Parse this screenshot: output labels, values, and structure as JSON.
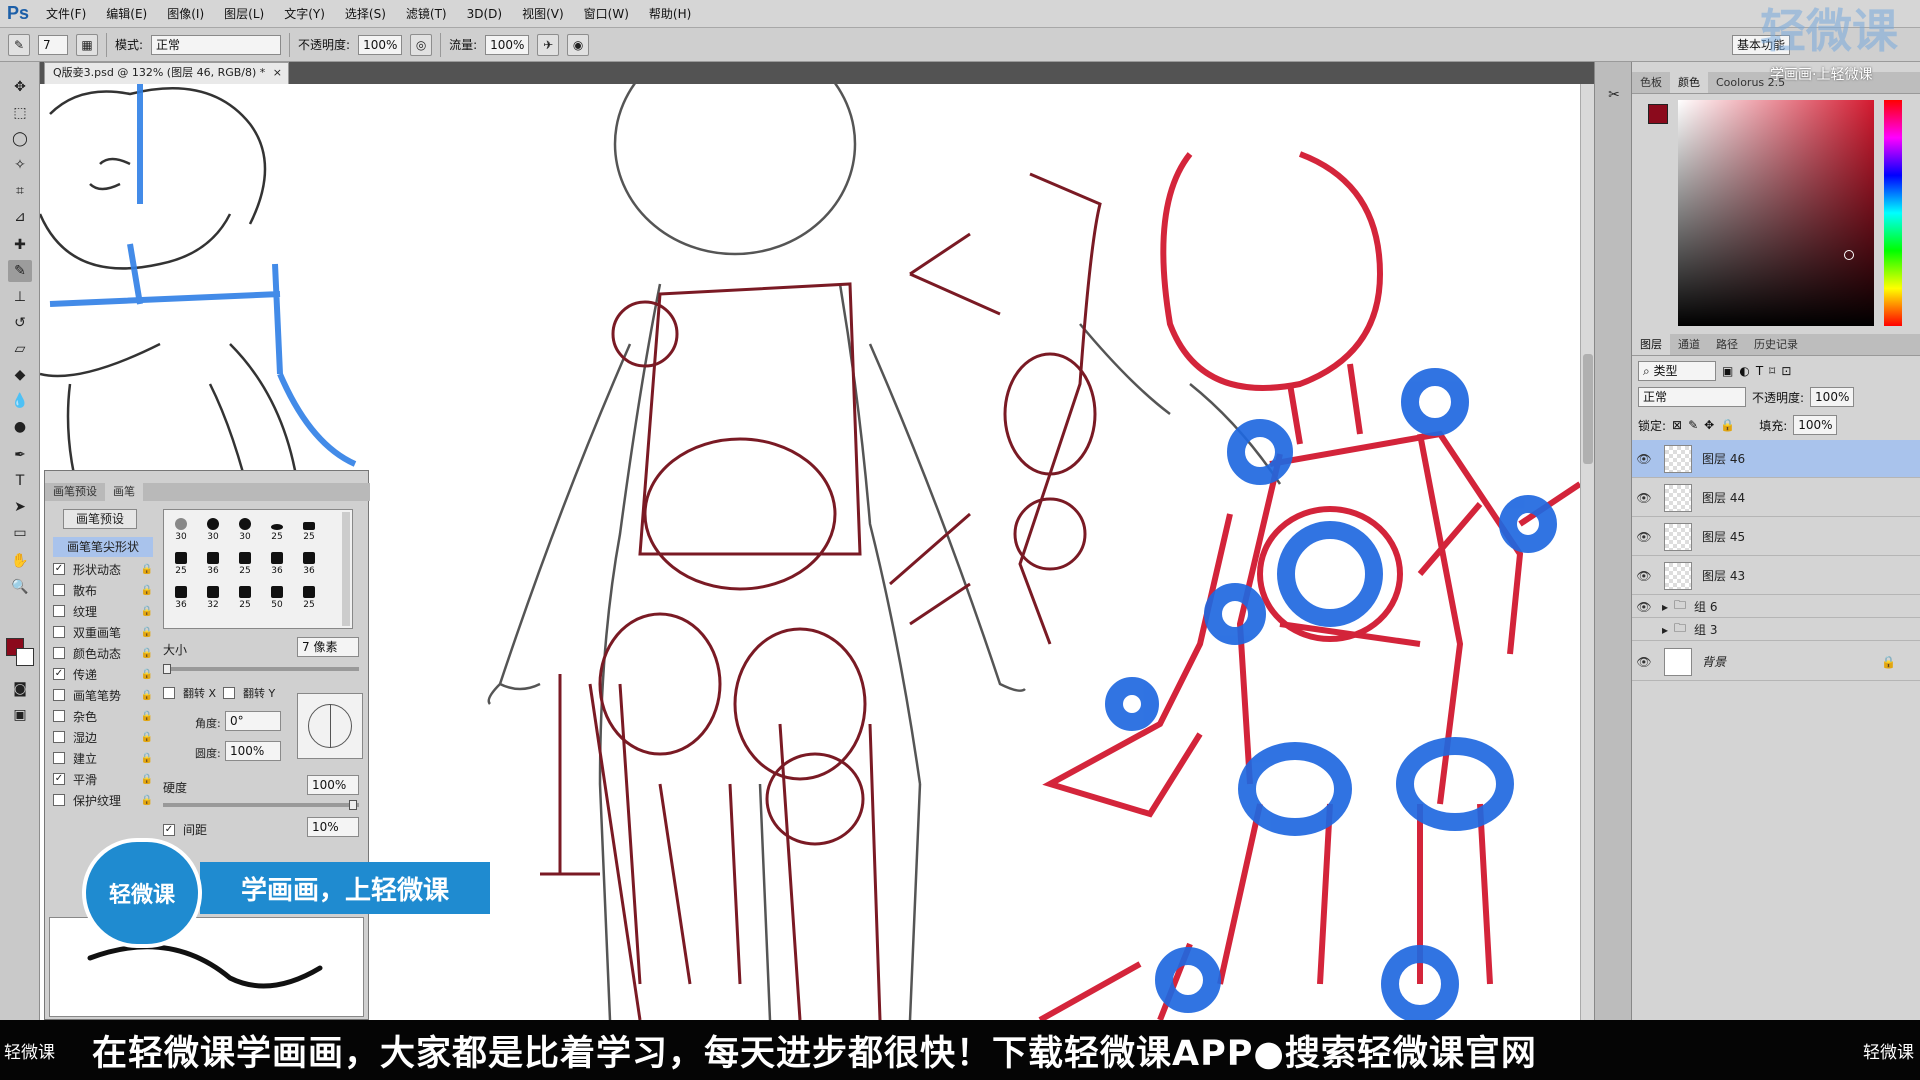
{
  "app": {
    "logo": "Ps"
  },
  "menu": [
    "文件(F)",
    "编辑(E)",
    "图像(I)",
    "图层(L)",
    "文字(Y)",
    "选择(S)",
    "滤镜(T)",
    "3D(D)",
    "视图(V)",
    "窗口(W)",
    "帮助(H)"
  ],
  "options": {
    "brush_size": "7",
    "mode_label": "模式:",
    "mode_value": "正常",
    "opacity_label": "不透明度:",
    "opacity_value": "100%",
    "flow_label": "流量:",
    "flow_value": "100%",
    "workspace": "基本功能"
  },
  "document": {
    "tab_title": "Q版妾3.psd @ 132% (图层 46, RGB/8) *"
  },
  "panels": {
    "color_tabs": [
      "色板",
      "颜色",
      "Coolorus 2.5"
    ],
    "foreground": "#8b0a1c",
    "background": "#ffffff",
    "layer_tabs": [
      "图层",
      "通道",
      "路径",
      "历史记录"
    ],
    "filter_label": "类型",
    "blend_mode": "正常",
    "opacity_label": "不透明度:",
    "opacity_value": "100%",
    "lock_label": "锁定:",
    "fill_label": "填充:",
    "fill_value": "100%",
    "layers": [
      {
        "name": "图层 46",
        "selected": true
      },
      {
        "name": "图层 44",
        "selected": false
      },
      {
        "name": "图层 45",
        "selected": false
      },
      {
        "name": "图层 43",
        "selected": false
      }
    ],
    "groups": [
      {
        "name": "组 6",
        "visible": true
      },
      {
        "name": "组 3",
        "visible": false
      }
    ],
    "background_layer": "背景"
  },
  "brush_panel": {
    "tabs": [
      "画笔预设",
      "画笔"
    ],
    "preset_button": "画笔预设",
    "tip_shape": "画笔笔尖形状",
    "options": [
      {
        "label": "形状动态",
        "checked": true
      },
      {
        "label": "散布",
        "checked": false
      },
      {
        "label": "纹理",
        "checked": false
      },
      {
        "label": "双重画笔",
        "checked": false
      },
      {
        "label": "颜色动态",
        "checked": false
      },
      {
        "label": "传递",
        "checked": true
      },
      {
        "label": "画笔笔势",
        "checked": false
      },
      {
        "label": "杂色",
        "checked": false
      },
      {
        "label": "湿边",
        "checked": false
      },
      {
        "label": "建立",
        "checked": false
      },
      {
        "label": "平滑",
        "checked": true
      },
      {
        "label": "保护纹理",
        "checked": false
      }
    ],
    "tip_sizes": [
      "30",
      "30",
      "30",
      "25",
      "25",
      "25",
      "36",
      "25",
      "36",
      "36",
      "36",
      "32",
      "25",
      "50",
      "25"
    ],
    "size_label": "大小",
    "size_value": "7 像素",
    "flip_x": "翻转 X",
    "flip_y": "翻转 Y",
    "angle_label": "角度:",
    "angle_value": "0°",
    "roundness_label": "圆度:",
    "roundness_value": "100%",
    "hardness_label": "硬度",
    "hardness_value": "100%",
    "spacing_label": "间距",
    "spacing_value": "10%"
  },
  "watermark": {
    "top": "轻微课",
    "sub": "学画画·上轻微课"
  },
  "promo": {
    "badge": "轻微课",
    "slogan": "学画画，上轻微课",
    "bottom_logo": "轻微课",
    "bottom_text": "在轻微课学画画，大家都是比着学习，每天进步都很快！下载轻微课APP●搜索轻微课官网"
  }
}
